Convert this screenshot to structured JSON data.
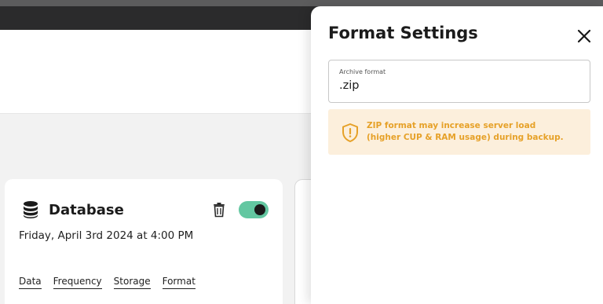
{
  "panel": {
    "title": "Format Settings",
    "archive_field": {
      "label": "Archive format",
      "value": ".zip"
    },
    "warning": {
      "text": "ZIP format may increase server load (higher CUP & RAM usage) during backup.",
      "icon": "shield-alert-icon"
    },
    "close_icon": "close-icon"
  },
  "card": {
    "title": "Database",
    "icon": "database-icon",
    "date": "Friday, April 3rd 2024 at 4:00 PM",
    "toggle_on": true,
    "links": [
      {
        "label": "Data"
      },
      {
        "label": "Frequency"
      },
      {
        "label": "Storage"
      },
      {
        "label": "Format"
      }
    ]
  },
  "colors": {
    "toggle_on": "#63c7a1",
    "warning_bg": "#fcefdc",
    "warning_text": "#e6a128",
    "top_bar": "#2b2b2c"
  }
}
